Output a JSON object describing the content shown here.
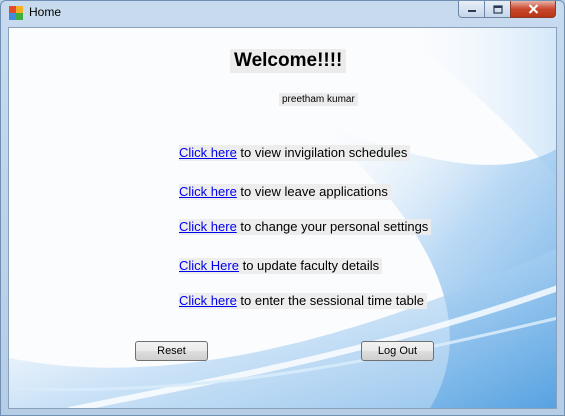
{
  "window": {
    "title": "Home",
    "controls": {
      "minimize": "minimize-icon",
      "maximize": "maximize-icon",
      "close": "close-icon"
    }
  },
  "main": {
    "welcome": "Welcome!!!!",
    "username": "preetham kumar",
    "links": [
      {
        "link_text": "Click here",
        "description": " to view invigilation schedules"
      },
      {
        "link_text": "Click here",
        "description": " to view leave applications"
      },
      {
        "link_text": "Click here",
        "description": " to change your personal settings"
      },
      {
        "link_text": "Click Here",
        "description": " to update faculty details"
      },
      {
        "link_text": "Click here",
        "description": " to enter the sessional time table"
      }
    ],
    "buttons": {
      "reset": "Reset",
      "logout": "Log Out"
    }
  },
  "colors": {
    "link": "#0000ee",
    "swoosh": "#7fb7e8"
  }
}
